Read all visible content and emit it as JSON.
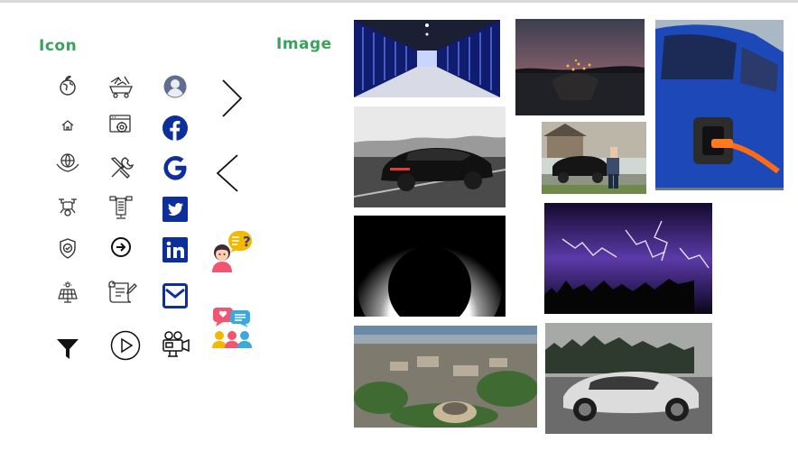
{
  "headings": {
    "icon": "Icon",
    "image": "Image"
  },
  "colors": {
    "heading_green": "#3aa35b",
    "brand_blue": "#0d2f9c",
    "icon_stroke": "#333333"
  },
  "icons": [
    "globe-hand-icon",
    "mining-cart-icon",
    "user-avatar-icon",
    "chevron-right-icon",
    "home-icon",
    "settings-window-icon",
    "facebook-icon",
    "globe-hands-icon",
    "tools-icon",
    "google-icon",
    "chevron-left-icon",
    "drone-icon",
    "server-network-icon",
    "twitter-icon",
    "shield-check-icon",
    "arrow-circle-right-icon",
    "linkedin-icon",
    "support-agent-question-icon",
    "solar-panel-icon",
    "certificate-icon",
    "mail-icon",
    "filter-icon",
    "play-circle-icon",
    "video-camera-icon",
    "team-chat-icon"
  ],
  "images": [
    "data-center-corridor",
    "sunset-lake-hands",
    "electric-car-charging",
    "black-sports-car-road",
    "woman-with-electric-car",
    "solar-eclipse",
    "lightning-storm",
    "aerial-campus-view",
    "white-supercar"
  ]
}
